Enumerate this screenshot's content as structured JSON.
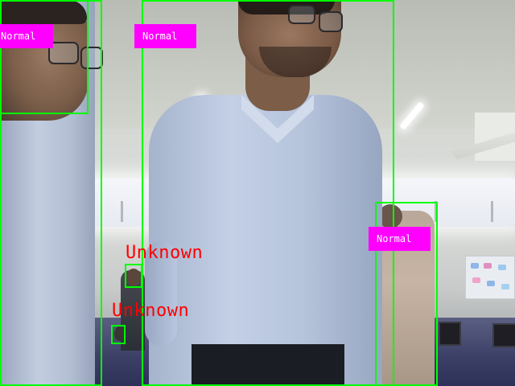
{
  "detections": {
    "person_1_label": "Normal",
    "person_2_label": "Normal",
    "person_3_label": "Normal",
    "face_1_label": "Unknown",
    "face_2_label": "Unknown"
  },
  "colors": {
    "box": "#00ff00",
    "label_background": "#ff00ff",
    "label_text": "#ffffff",
    "unknown_text": "#ff0000"
  }
}
